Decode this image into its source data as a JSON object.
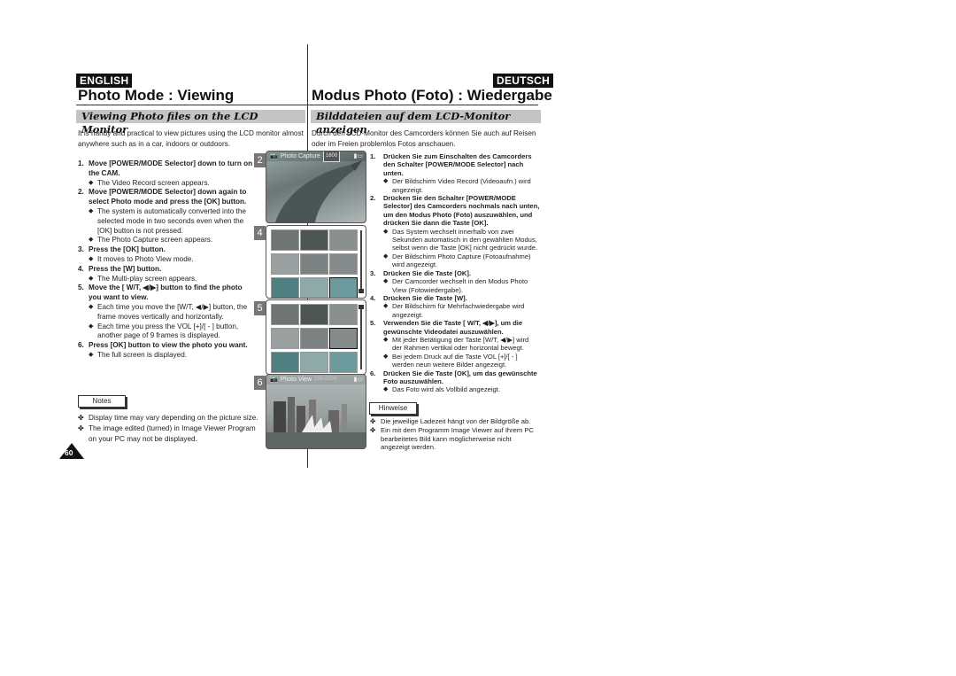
{
  "en": {
    "lang_label": "ENGLISH",
    "title": "Photo Mode : Viewing",
    "subtitle": "Viewing Photo files on the LCD Monitor",
    "intro": "It is handy and practical to view pictures using the LCD monitor almost anywhere such as in a car, indoors or outdoors.",
    "steps": [
      {
        "num": "1.",
        "text": "Move [POWER/MODE Selector] down to turn on the CAM.",
        "bullets": [
          "The Video Record screen appears."
        ]
      },
      {
        "num": "2.",
        "text": "Move [POWER/MODE Selector] down again to select Photo mode and press the [OK] button.",
        "bullets": [
          "The system is automatically converted into the selected mode in two seconds even when the [OK] button is not pressed.",
          "The Photo Capture screen appears."
        ]
      },
      {
        "num": "3.",
        "text": "Press the [OK] button.",
        "bullets": [
          "It moves to Photo View mode."
        ]
      },
      {
        "num": "4.",
        "text": "Press the [W] button.",
        "bullets": [
          "The Multi-play screen appears."
        ]
      },
      {
        "num": "5.",
        "text": "Move the [ W/T, ◀/▶] button to find the photo you want to view.",
        "bullets": [
          "Each time you move the [W/T, ◀/▶] button, the frame moves vertically and horizontally.",
          "Each time you press the VOL [+]/[ - ] button, another page of 9 frames is displayed."
        ]
      },
      {
        "num": "6.",
        "text": "Press [OK] button to view the photo you want.",
        "bullets": [
          "The full screen is displayed."
        ]
      }
    ],
    "notes_label": "Notes",
    "notes": [
      "Display time may vary depending on the picture size.",
      "The image edited (turned) in Image Viewer Program on your PC may not be displayed."
    ]
  },
  "de": {
    "lang_label": "DEUTSCH",
    "title": "Modus Photo (Foto) : Wiedergabe",
    "subtitle": "Bilddateien auf dem LCD-Monitor anzeigen",
    "intro": "Durch den LCD-Monitor des Camcorders können Sie auch auf Reisen oder im Freien problemlos Fotos anschauen.",
    "steps": [
      {
        "num": "1.",
        "text": "Drücken Sie zum Einschalten des Camcorders den Schalter [POWER/MODE Selector] nach unten.",
        "bullets": [
          "Der Bildschirm Video Record (Videoaufn.) wird angezeigt."
        ]
      },
      {
        "num": "2.",
        "text": "Drücken Sie den Schalter [POWER/MODE Selector] des Camcorders nochmals nach unten, um den Modus Photo (Foto) auszuwählen, und drücken Sie dann die Taste [OK].",
        "bullets": [
          "Das System wechselt innerhalb von zwei Sekunden automatisch in den gewählten Modus, selbst wenn die Taste [OK] nicht gedrückt wurde.",
          "Der Bildschirm Photo Capture (Fotoaufnahme) wird angezeigt."
        ]
      },
      {
        "num": "3.",
        "text": "Drücken Sie die Taste [OK].",
        "bullets": [
          "Der Camcorder wechselt in den Modus Photo View (Fotowiedergabe)."
        ]
      },
      {
        "num": "4.",
        "text": "Drücken Sie die Taste [W].",
        "bullets": [
          "Der Bildschirm für Mehrfachwiedergabe wird angezeigt."
        ]
      },
      {
        "num": "5.",
        "text": "Verwenden Sie die Taste [ W/T, ◀/▶], um die gewünschte Videodatei auszuwählen.",
        "bullets": [
          "Mit jeder Betätigung der Taste [W/T, ◀/▶] wird der Rahmen vertikal oder horizontal bewegt.",
          "Bei jedem Druck auf die Taste VOL [+]/[ - ] werden neun weitere Bilder angezeigt."
        ]
      },
      {
        "num": "6.",
        "text": "Drücken Sie die Taste [OK], um das gewünschte Foto auszuwählen.",
        "bullets": [
          "Das Foto wird als Vollbild angezeigt."
        ]
      }
    ],
    "notes_label": "Hinweise",
    "notes": [
      "Die jeweilige Ladezeit hängt von der Bildgröße ab.",
      "Ein mit dem Programm Image Viewer auf Ihrem PC bearbeitetes Bild kann möglicherweise nicht angezeigt werden."
    ]
  },
  "figures": {
    "fig2": {
      "num": "2",
      "mode_label": "Photo Capture",
      "quality_badge": "1600"
    },
    "fig4": {
      "num": "4"
    },
    "fig5": {
      "num": "5"
    },
    "fig6": {
      "num": "6",
      "mode_label": "Photo View",
      "counter": "100-0024"
    }
  },
  "page_number": "60",
  "bullet_glyph": "◆",
  "note_glyph": "✤"
}
